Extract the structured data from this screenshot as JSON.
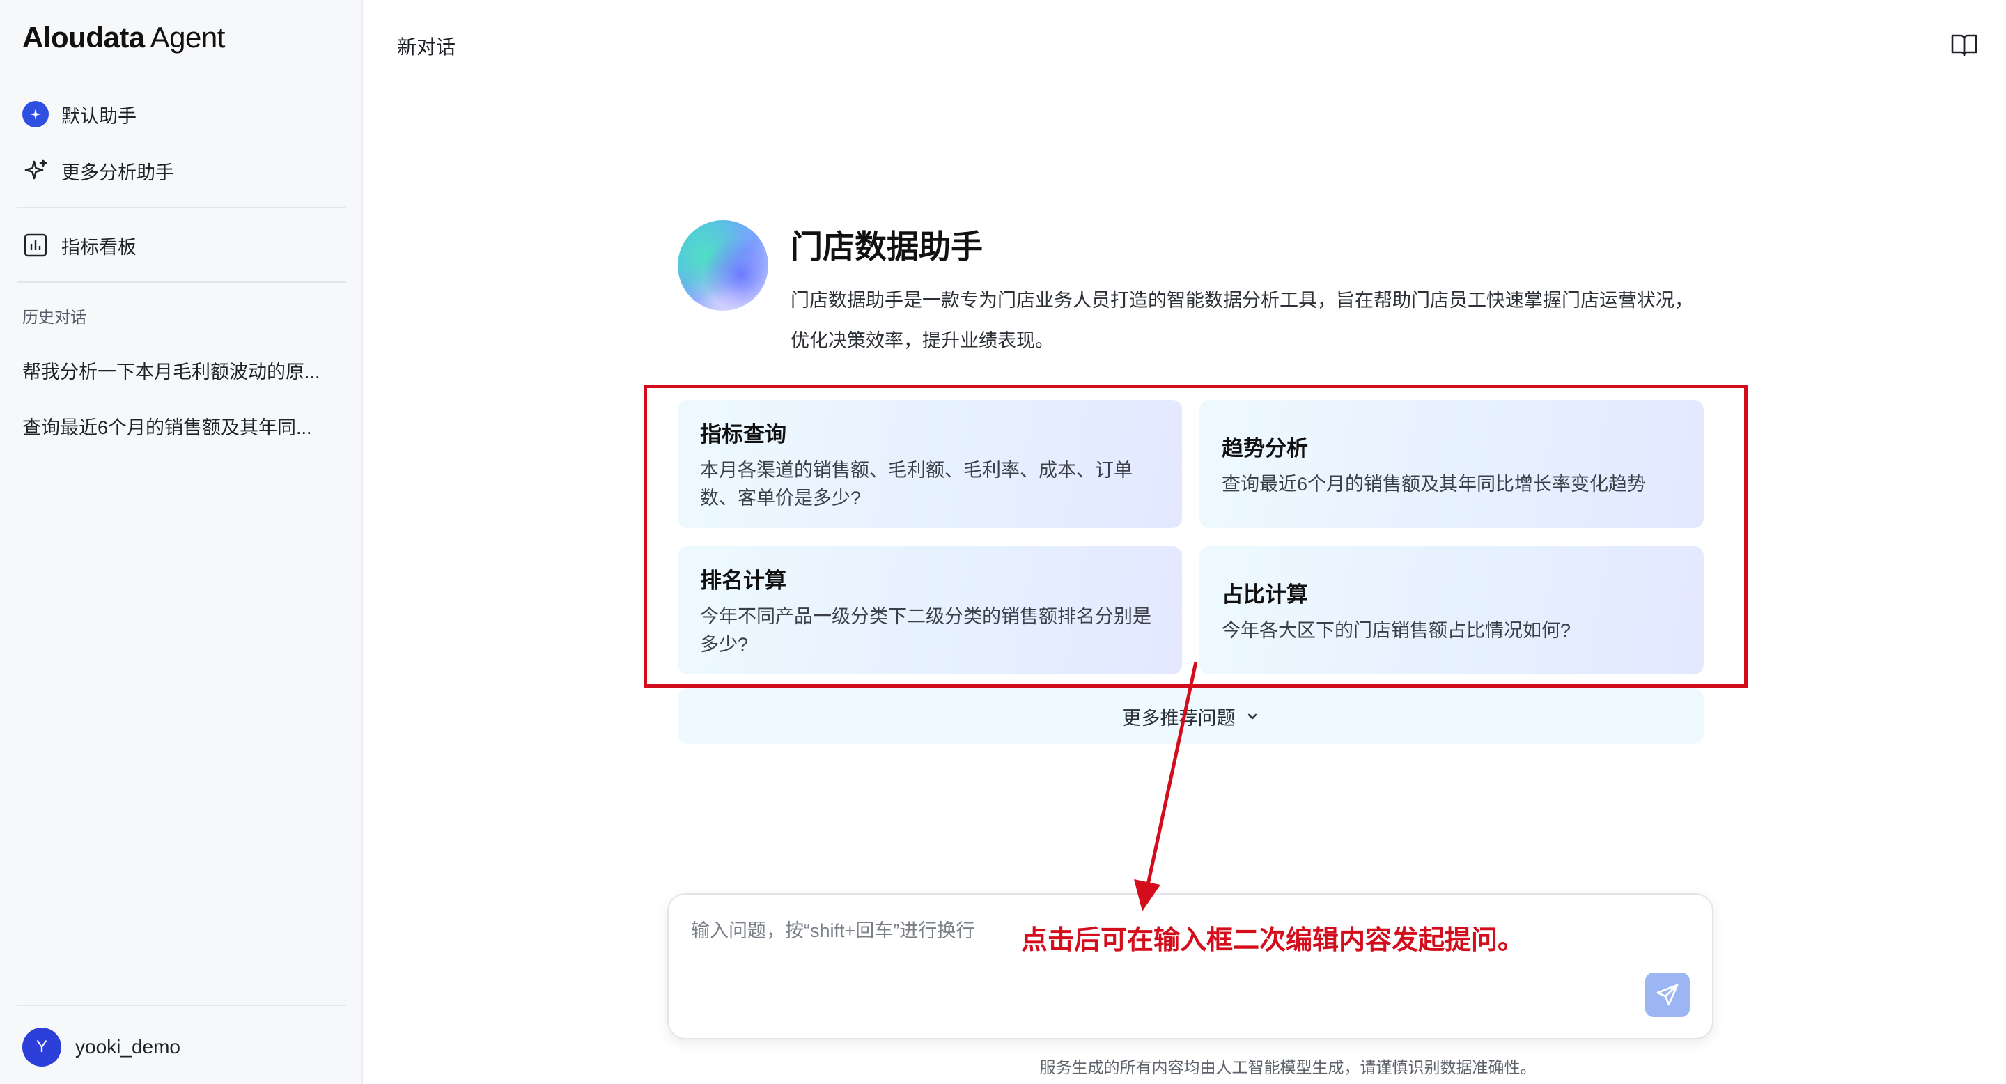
{
  "app": {
    "logo_brand": "Aloudata",
    "logo_suffix": "Agent"
  },
  "sidebar": {
    "items": [
      {
        "label": "默认助手",
        "icon": "sparkle-badge-icon"
      },
      {
        "label": "更多分析助手",
        "icon": "sparkle-icon"
      },
      {
        "label": "指标看板",
        "icon": "bar-chart-icon"
      }
    ],
    "history_label": "历史对话",
    "history": [
      "帮我分析一下本月毛利额波动的原...",
      "查询最近6个月的销售额及其年同..."
    ],
    "user": {
      "initial": "Y",
      "name": "yooki_demo"
    }
  },
  "header": {
    "title": "新对话",
    "right_icon": "book-open-icon"
  },
  "assistant": {
    "name": "门店数据助手",
    "description": "门店数据助手是一款专为门店业务人员打造的智能数据分析工具，旨在帮助门店员工快速掌握门店运营状况，优化决策效率，提升业绩表现。"
  },
  "suggestions": [
    {
      "title": "指标查询",
      "text": "本月各渠道的销售额、毛利额、毛利率、成本、订单数、客单价是多少?"
    },
    {
      "title": "趋势分析",
      "text": "查询最近6个月的销售额及其年同比增长率变化趋势"
    },
    {
      "title": "排名计算",
      "text": "今年不同产品一级分类下二级分类的销售额排名分别是多少?"
    },
    {
      "title": "占比计算",
      "text": "今年各大区下的门店销售额占比情况如何?"
    }
  ],
  "more_suggestions_label": "更多推荐问题",
  "input": {
    "placeholder": "输入问题，按“shift+回车”进行换行",
    "value": ""
  },
  "annotation": {
    "text": "点击后可在输入框二次编辑内容发起提问。",
    "color": "#d40d1c"
  },
  "disclaimer": "服务生成的所有内容均由人工智能模型生成，请谨慎识别数据准确性。",
  "colors": {
    "accent": "#2f4fe0",
    "send_button": "#9bb6f3"
  }
}
